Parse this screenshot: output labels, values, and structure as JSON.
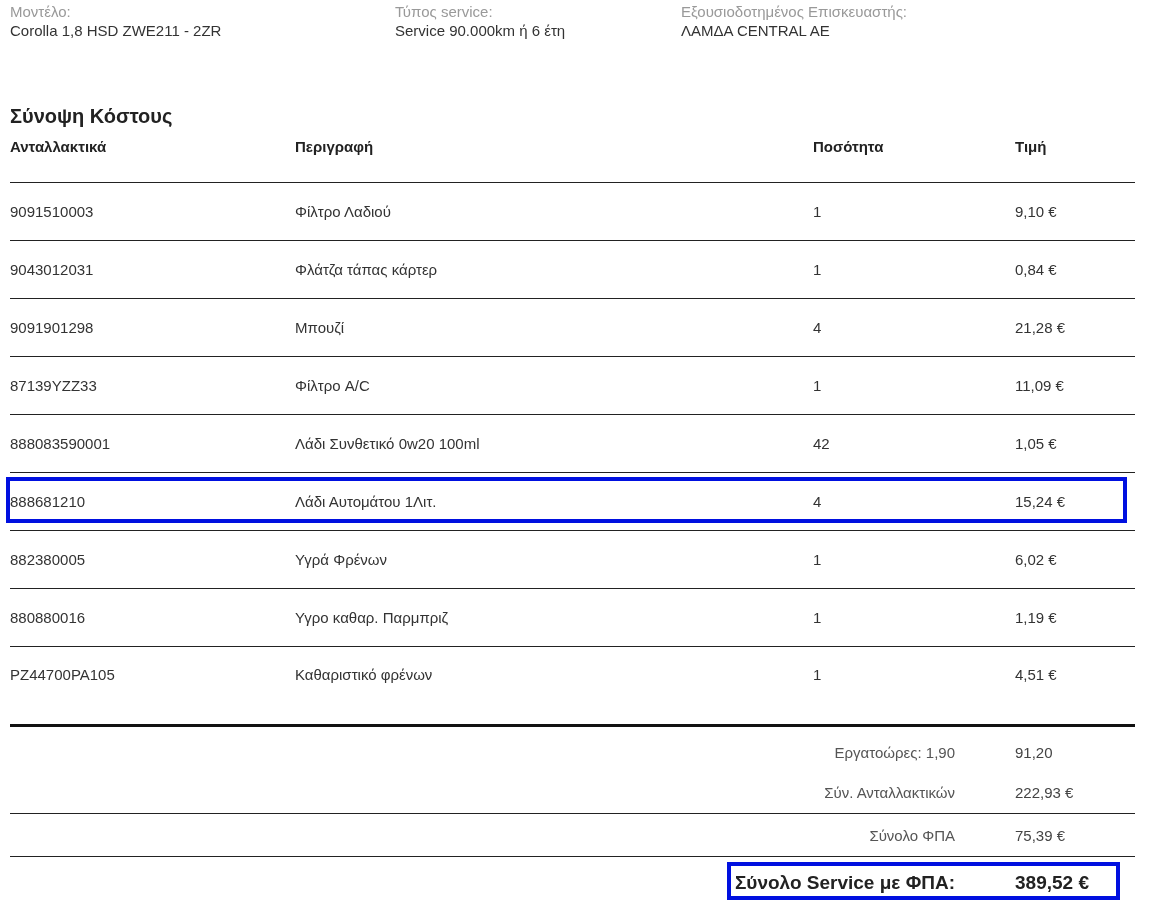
{
  "info": [
    {
      "label": "Μοντέλο:",
      "value": "Corolla 1,8 HSD ZWE211 - 2ZR"
    },
    {
      "label": "Τύπος service:",
      "value": "Service 90.000km ή 6 έτη"
    },
    {
      "label": "Εξουσιοδοτημένος Επισκευαστής:",
      "value": "ΛΑΜΔΑ CENTRAL AE"
    }
  ],
  "section_title": "Σύνοψη Κόστους",
  "columns": [
    "Ανταλλακτικά",
    "Περιγραφή",
    "Ποσότητα",
    "Τιμή"
  ],
  "rows": [
    {
      "part": "9091510003",
      "description": "Φίλτρο Λαδιού",
      "quantity": "1",
      "price": "9,10 €",
      "highlighted": false
    },
    {
      "part": "9043012031",
      "description": "Φλάτζα τάπας κάρτερ",
      "quantity": "1",
      "price": "0,84 €",
      "highlighted": false
    },
    {
      "part": "9091901298",
      "description": "Μπουζί",
      "quantity": "4",
      "price": "21,28 €",
      "highlighted": false
    },
    {
      "part": "87139YZZ33",
      "description": "Φίλτρο A/C",
      "quantity": "1",
      "price": "11,09 €",
      "highlighted": false
    },
    {
      "part": "888083590001",
      "description": "Λάδι Συνθετικό 0w20 100ml",
      "quantity": "42",
      "price": "1,05 €",
      "highlighted": false
    },
    {
      "part": "888681210",
      "description": "Λάδι Αυτομάτου 1Λιτ.",
      "quantity": "4",
      "price": "15,24 €",
      "highlighted": true
    },
    {
      "part": "882380005",
      "description": "Υγρά Φρένων",
      "quantity": "1",
      "price": "6,02 €",
      "highlighted": false
    },
    {
      "part": "880880016",
      "description": "Υγρο καθαρ. Παρμπριζ",
      "quantity": "1",
      "price": "1,19 €",
      "highlighted": false
    },
    {
      "part": "PZ44700PA105",
      "description": "Καθαριστικό φρένων",
      "quantity": "1",
      "price": "4,51 €",
      "highlighted": false
    }
  ],
  "summary": [
    {
      "label": "Εργατοώρες: 1,90",
      "value": "91,20",
      "divider_after": false
    },
    {
      "label": "Σύν. Ανταλλακτικών",
      "value": "222,93 €",
      "divider_after": true
    },
    {
      "label": "Σύνολο ΦΠΑ",
      "value": "75,39 €",
      "divider_after": true
    }
  ],
  "total": {
    "label": "Σύνολο Service με ΦΠΑ:",
    "value": "389,52 €",
    "highlighted": true
  }
}
